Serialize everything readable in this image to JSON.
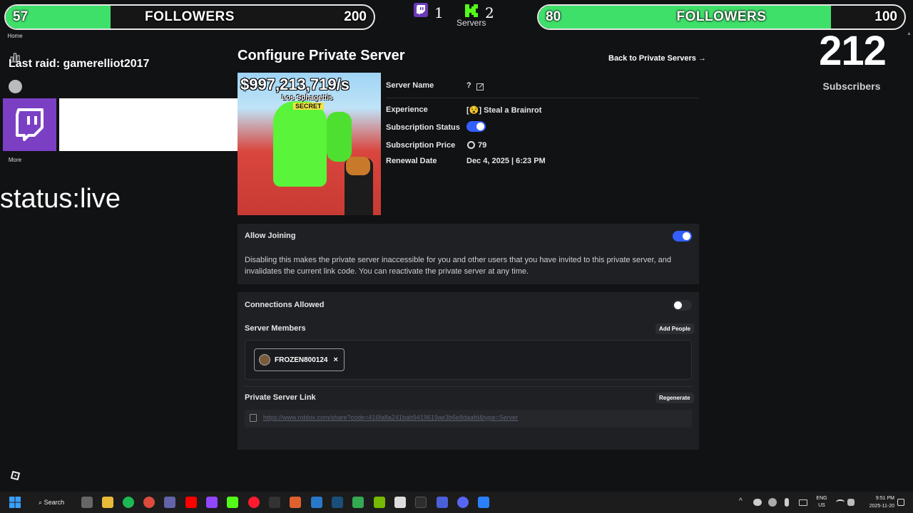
{
  "overlay": {
    "followers_left": {
      "current": "57",
      "label": "FOLLOWERS",
      "goal": "200",
      "progress": 0.285
    },
    "followers_right": {
      "current": "80",
      "label": "FOLLOWERS",
      "goal": "100",
      "progress": 0.8
    },
    "twitch_count": "1",
    "kick_count": "2",
    "servers_label": "Servers",
    "subscriber_count": "212",
    "subscribers_label": "Subscribers",
    "last_raid": "Last raid: gamerelliot2017",
    "status_text": "status:live"
  },
  "sidebar": {
    "home_label": "Home",
    "more_label": "More"
  },
  "page": {
    "title": "Configure Private Server",
    "back_link": "Back to Private Servers →",
    "thumbnail": {
      "price_text": "$997,213,719/s",
      "name_text": "Los Sphagettis",
      "rarity_text": "SECRET"
    },
    "info": {
      "server_name_label": "Server Name",
      "server_name_value": "?",
      "experience_label": "Experience",
      "experience_value": "[😵] Steal a Brainrot",
      "subscription_status_label": "Subscription Status",
      "subscription_status_on": true,
      "subscription_price_label": "Subscription Price",
      "subscription_price_value": "79",
      "renewal_date_label": "Renewal Date",
      "renewal_date_value": "Dec 4, 2025 | 6:23 PM"
    },
    "allow_joining": {
      "label": "Allow Joining",
      "on": true,
      "description": "Disabling this makes the private server inaccessible for you and other users that you have invited to this private server, and invalidates the current link code. You can reactivate the private server at any time."
    },
    "connections": {
      "label": "Connections Allowed",
      "on": false,
      "members_label": "Server Members",
      "add_people_label": "Add People",
      "members": [
        "FROZEN800124"
      ],
      "link_label": "Private Server Link",
      "regenerate_label": "Regenerate",
      "link_url": "https://www.roblox.com/share?code=416fa8a241bab9419619ae3b6e8daafd&type=Server"
    }
  },
  "taskbar": {
    "search_label": "Search",
    "lang_top": "ENG",
    "lang_bottom": "US",
    "time": "9:51 PM",
    "date": "2025-11-20"
  },
  "colors": {
    "follower_fill": "#3fe06a",
    "toggle_on": "#335fff",
    "twitch_purple": "#7b3fc4",
    "kick_green": "#53fc18"
  }
}
